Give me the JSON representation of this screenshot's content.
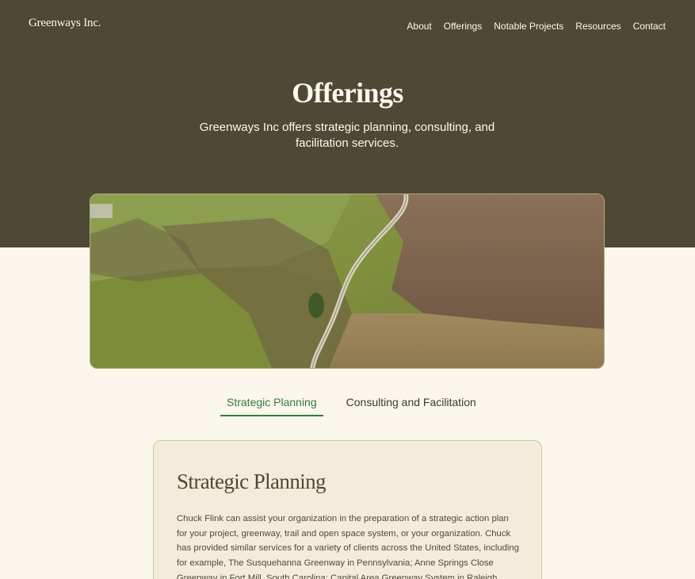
{
  "brand": "Greenways Inc.",
  "nav": [
    "About",
    "Offerings",
    "Notable Projects",
    "Resources",
    "Contact"
  ],
  "hero": {
    "title": "Offerings",
    "subtitle": "Greenways Inc offers strategic planning, consulting, and facilitation services."
  },
  "tabs": [
    {
      "label": "Strategic Planning",
      "active": true
    },
    {
      "label": "Consulting and Facilitation",
      "active": false
    }
  ],
  "section": {
    "heading": "Strategic Planning",
    "body": "Chuck Flink can assist your organization in the preparation of a strategic action plan for your project, greenway, trail and open space system, or your organization. Chuck has provided similar services for a variety of clients across the United States, including for example, The Susquehanna Greenway in Pennsylvania; Anne Springs Close Greenway in Fort Mill, South Carolina; Capital Area Greenway System in Raleigh, North Carolina; Las"
  },
  "colors": {
    "header_bg": "#4e4934",
    "page_bg": "#fbf7ec",
    "card_bg": "#f4ecda",
    "accent": "#2e7d3e"
  }
}
